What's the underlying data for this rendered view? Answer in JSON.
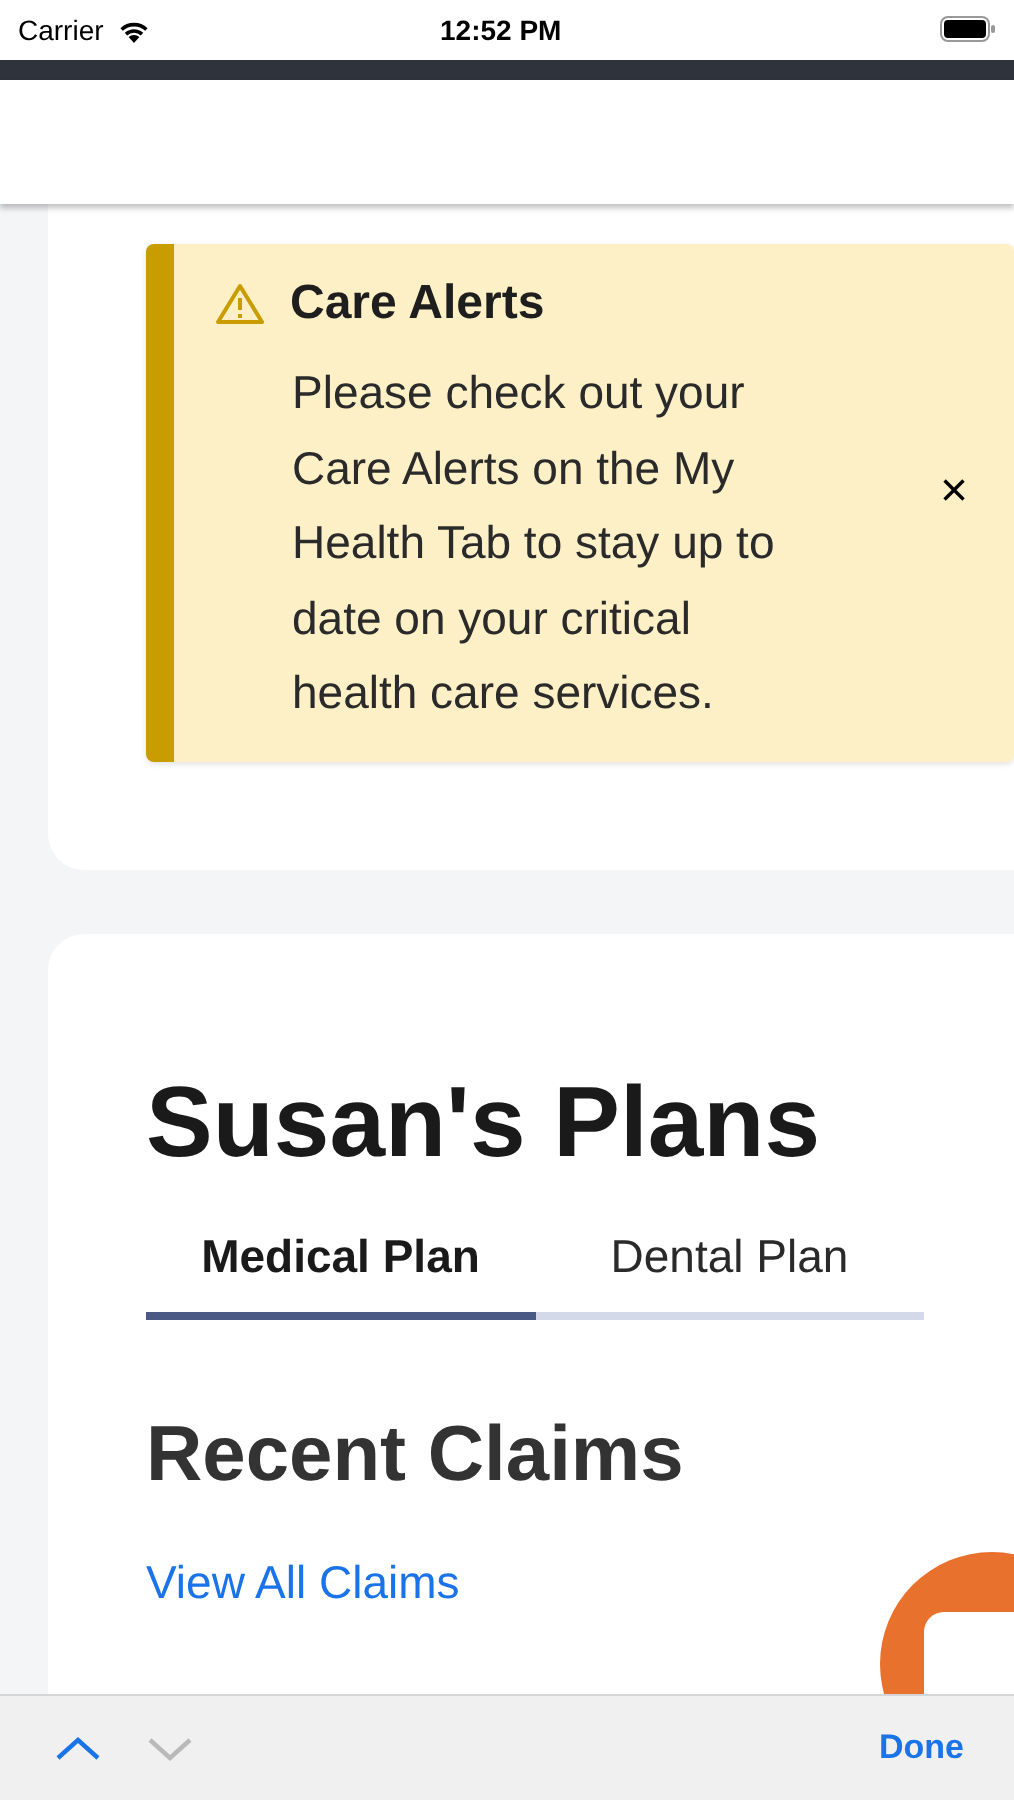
{
  "status_bar": {
    "carrier": "Carrier",
    "time": "12:52 PM"
  },
  "alert": {
    "title": "Care Alerts",
    "message": "Please check out your Care Alerts on the My Health Tab to stay up to date on your critical health care services.",
    "close": "×"
  },
  "plans": {
    "title": "Susan's Plans",
    "tabs": [
      {
        "label": "Medical Plan",
        "selected": true
      },
      {
        "label": "Dental Plan",
        "selected": false
      }
    ]
  },
  "recent_claims": {
    "title": "Recent Claims",
    "link": "View All Claims"
  },
  "accessory_bar": {
    "nav_buttons": [
      {
        "kind": "up",
        "disabled": false
      },
      {
        "kind": "down",
        "disabled": true
      }
    ],
    "done": "Done"
  }
}
